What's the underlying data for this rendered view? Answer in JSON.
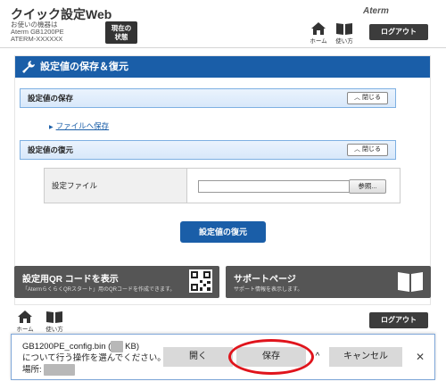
{
  "header": {
    "app_title": "クイック設定Web",
    "device_line1": "お使いの機器は",
    "device_line2": "Aterm GB1200PE",
    "device_line3": "ATERM-XXXXXX",
    "status_button_line1": "現在の",
    "status_button_line2": "状態",
    "home_label": "ホーム",
    "manual_label": "使い方",
    "logo": "Aterm",
    "logout_label": "ログアウト"
  },
  "main": {
    "section_title": "設定値の保存＆復元",
    "save_section": {
      "title": "設定値の保存",
      "collapse_label": "閉じる",
      "link_label": "ファイルへ保存"
    },
    "restore_section": {
      "title": "設定値の復元",
      "collapse_label": "閉じる"
    },
    "file_row": {
      "label": "設定ファイル",
      "input_value": "",
      "browse_label": "参照..."
    },
    "restore_button_label": "設定値の復元"
  },
  "tiles": {
    "qr": {
      "title": "設定用QR コードを表示",
      "description": "「AtermらくらくQRスタート」用のQRコードを作成できます。",
      "icon": "qr-code-icon"
    },
    "support": {
      "title": "サポートページ",
      "description": "サポート情報を表示します。",
      "icon": "book-icon"
    }
  },
  "footer": {
    "home_label": "ホーム",
    "manual_label": "使い方",
    "logout_label": "ログアウト"
  },
  "download_bar": {
    "file_name": "GB1200PE_config.bin",
    "size_open": "(",
    "size_unit": "KB)",
    "line2": "について行う操作を選んでください。",
    "location_label": "場所:",
    "open_label": "開く",
    "save_label": "保存",
    "chevron": "^",
    "cancel_label": "キャンセル",
    "close": "✕"
  },
  "colors": {
    "accent": "#1a5ea8",
    "highlight": "#e0141c",
    "dark_button": "#3c3c3c"
  }
}
